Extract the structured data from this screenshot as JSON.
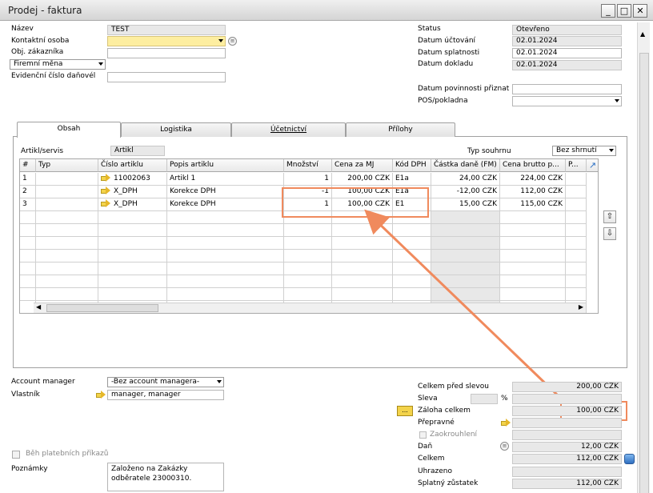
{
  "window": {
    "title": "Prodej - faktura",
    "min": "_",
    "max": "□",
    "close": "✕"
  },
  "header_left": {
    "name_label": "Název",
    "name_value": "TEST",
    "contact_label": "Kontaktní osoba",
    "contact_value": "",
    "customer_ref_label": "Obj. zákazníka",
    "customer_ref_value": "",
    "currency_label": "Firemní měna",
    "tax_doc_label": "Evidenční číslo daňovél",
    "tax_doc_value": ""
  },
  "header_right": {
    "status_label": "Status",
    "status_value": "Otevřeno",
    "posting_label": "Datum účtování",
    "posting_value": "02.01.2024",
    "due_label": "Datum splatnosti",
    "due_value": "02.01.2024",
    "doc_label": "Datum dokladu",
    "doc_value": "02.01.2024",
    "tax_date_label": "Datum povinnosti přiznat",
    "tax_date_value": "",
    "pos_label": "POS/pokladna",
    "pos_value": ""
  },
  "tabs": [
    "Obsah",
    "Logistika",
    "Účetnictví",
    "Přílohy"
  ],
  "content": {
    "item_service_label": "Artikl/servis",
    "item_service_value": "Artikl",
    "summary_type_label": "Typ souhrnu",
    "summary_type_value": "Bez shrnutí"
  },
  "grid": {
    "columns": [
      "#",
      "Typ",
      "Číslo artiklu",
      "Popis artiklu",
      "Množství",
      "Cena za MJ",
      "Kód DPH",
      "Částka daně (FM)",
      "Cena brutto p...",
      "P..."
    ],
    "rows": [
      {
        "no": "1",
        "type": "",
        "item": "11002063",
        "desc": "Artikl 1",
        "qty": "1",
        "price": "200,00 CZK",
        "vat": "E1a",
        "tax": "24,00 CZK",
        "gross": "224,00 CZK"
      },
      {
        "no": "2",
        "type": "",
        "item": "X_DPH",
        "desc": "Korekce DPH",
        "qty": "-1",
        "price": "100,00 CZK",
        "vat": "E1a",
        "tax": "-12,00 CZK",
        "gross": "112,00 CZK"
      },
      {
        "no": "3",
        "type": "",
        "item": "X_DPH",
        "desc": "Korekce DPH",
        "qty": "1",
        "price": "100,00 CZK",
        "vat": "E1",
        "tax": "15,00 CZK",
        "gross": "115,00 CZK"
      }
    ]
  },
  "footer_left": {
    "account_manager_label": "Account manager",
    "account_manager_value": "-Bez account managera-",
    "owner_label": "Vlastník",
    "owner_value": "manager, manager",
    "payment_run_label": "Běh platebních příkazů",
    "remarks_label": "Poznámky",
    "remarks_value": "Založeno na Zakázky odběratele 23000310."
  },
  "totals": {
    "before_discount_label": "Celkem před slevou",
    "before_discount_value": "200,00 CZK",
    "discount_label": "Sleva",
    "discount_pct_sign": "%",
    "advance_label": "Záloha celkem",
    "advance_value": "100,00 CZK",
    "advance_btn": "...",
    "freight_label": "Přepravné",
    "rounding_label": "Zaokrouhlení",
    "tax_label": "Daň",
    "tax_value": "12,00 CZK",
    "total_label": "Celkem",
    "total_value": "112,00 CZK",
    "paid_label": "Uhrazeno",
    "paid_value": "",
    "balance_label": "Splatný zůstatek",
    "balance_value": "112,00 CZK"
  },
  "colors": {
    "highlight": "#f08a5d",
    "yellow_field": "#fdeea0",
    "readonly": "#e8e8e8"
  }
}
